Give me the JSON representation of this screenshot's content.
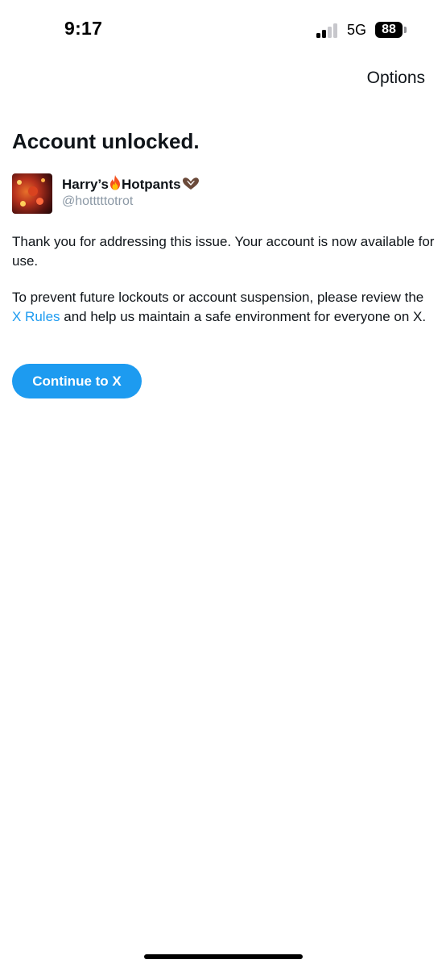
{
  "status_bar": {
    "time": "9:17",
    "network": "5G",
    "battery": "88",
    "signal_bars_active": 2,
    "signal_bars_total": 4
  },
  "header": {
    "options_label": "Options"
  },
  "main": {
    "title": "Account unlocked.",
    "account": {
      "display_name_part1": "Harry’s",
      "display_name_part2": "Hotpants",
      "handle": "@hotttttotrot"
    },
    "paragraph1": "Thank you for addressing this issue. Your account is now available for use.",
    "paragraph2_before": "To prevent future lockouts or account suspension, please review the ",
    "paragraph2_link": "X Rules",
    "paragraph2_after": " and help us maintain a safe environment for everyone on X.",
    "continue_label": "Continue to X"
  },
  "colors": {
    "accent": "#1d9bf0",
    "text": "#0f1419",
    "secondary_text": "#8b98a5"
  },
  "icons": {
    "fire": "fire-emoji-icon",
    "heart_hands": "heart-hands-emoji-icon"
  }
}
